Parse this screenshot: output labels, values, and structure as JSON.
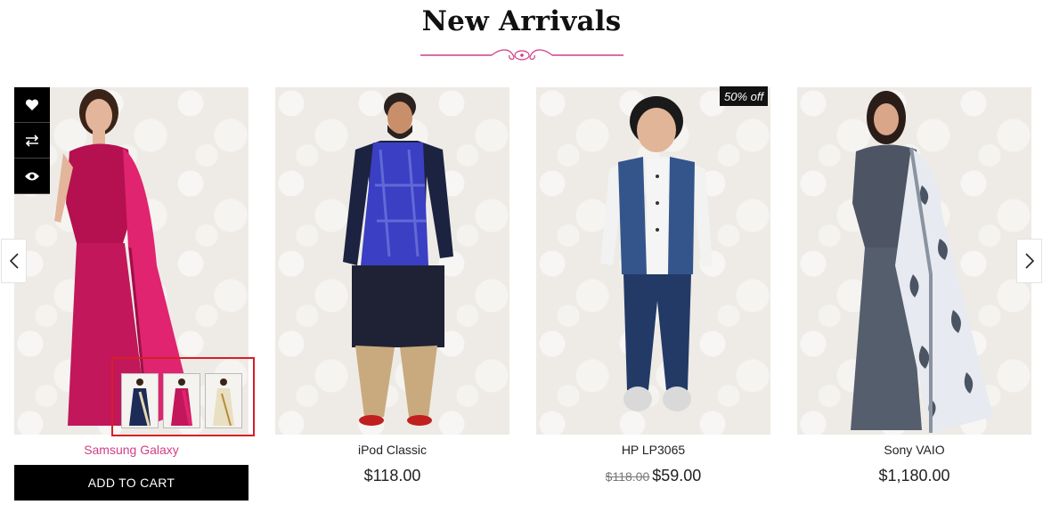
{
  "section": {
    "title": "New Arrivals"
  },
  "products": [
    {
      "name": "Samsung Galaxy",
      "price": ""
    },
    {
      "name": "iPod Classic",
      "price": "$118.00"
    },
    {
      "name": "HP LP3065",
      "old_price": "$118.00",
      "price": "$59.00",
      "badge": "50% off"
    },
    {
      "name": "Sony VAIO",
      "price": "$1,180.00"
    }
  ],
  "card_actions": {
    "add_to_cart": "ADD TO CART"
  },
  "icons": {
    "wishlist": "heart-icon",
    "compare": "compare-arrows-icon",
    "quickview": "eye-icon",
    "prev": "chevron-left-icon",
    "next": "chevron-right-icon"
  },
  "colors": {
    "accent": "#cf3f86",
    "button": "#000000",
    "highlight_border": "#d61f26"
  }
}
